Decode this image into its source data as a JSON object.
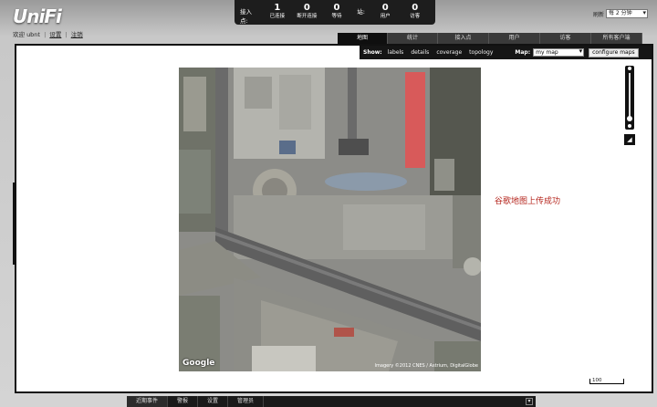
{
  "app": {
    "logo": "UniFi"
  },
  "welcome": {
    "prefix": "欢迎 ubnt",
    "settings": "设置",
    "logout": "注销"
  },
  "stats": {
    "label": "接入点:",
    "items": [
      {
        "value": "1",
        "caption": "已连接"
      },
      {
        "value": "0",
        "caption": "断开连接"
      },
      {
        "value": "0",
        "caption": "等待"
      }
    ],
    "station_label": "站:",
    "station_items": [
      {
        "value": "0",
        "caption": "用户"
      },
      {
        "value": "0",
        "caption": "访客"
      }
    ]
  },
  "refresh": {
    "label": "刷新",
    "value": "每 2 分钟"
  },
  "tabs": [
    {
      "label": "地图",
      "active": true
    },
    {
      "label": "统计"
    },
    {
      "label": "接入点"
    },
    {
      "label": "用户"
    },
    {
      "label": "访客"
    },
    {
      "label": "所有客户端"
    }
  ],
  "toolbar": {
    "show_label": "Show:",
    "options": [
      "labels",
      "details",
      "coverage",
      "topology"
    ],
    "map_label": "Map:",
    "map_value": "my map",
    "configure_label": "configure maps"
  },
  "map": {
    "google_label": "Google",
    "credit": "Imagery ©2012 CNES / Astrium, DigitalGlobe",
    "success_message": "谷歌地图上传成功",
    "scale_label": "100"
  },
  "bottom": {
    "tabs": [
      "近期事件",
      "警报",
      "设置",
      "管理员"
    ]
  }
}
